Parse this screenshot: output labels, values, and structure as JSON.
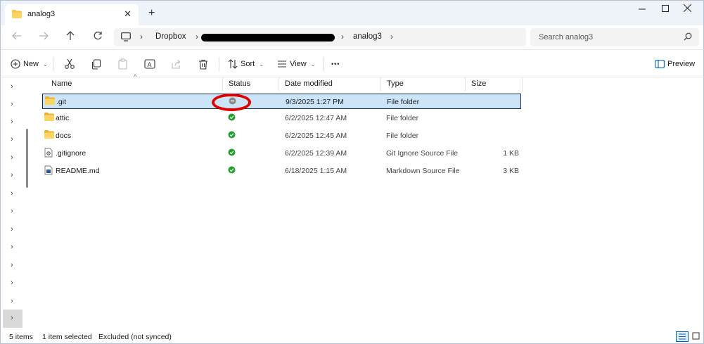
{
  "window": {
    "tab_title": "analog3",
    "new_tab_glyph": "+",
    "tab_close_glyph": "✕"
  },
  "address": {
    "segments": [
      "Dropbox",
      "analog3"
    ],
    "search_placeholder": "Search analog3"
  },
  "toolbar": {
    "new_label": "New",
    "sort_label": "Sort",
    "view_label": "View",
    "more_label": "•••",
    "preview_label": "Preview"
  },
  "columns": {
    "name": "Name",
    "status": "Status",
    "date": "Date modified",
    "type": "Type",
    "size": "Size"
  },
  "files": [
    {
      "name": ".git",
      "status": "excluded",
      "date": "9/3/2025 1:27 PM",
      "type": "File folder",
      "size": "",
      "icon": "folder-icon"
    },
    {
      "name": "attic",
      "status": "synced",
      "date": "6/2/2025 12:47 AM",
      "type": "File folder",
      "size": "",
      "icon": "folder-icon"
    },
    {
      "name": "docs",
      "status": "synced",
      "date": "6/2/2025 12:45 AM",
      "type": "File folder",
      "size": "",
      "icon": "folder-icon"
    },
    {
      "name": ".gitignore",
      "status": "synced",
      "date": "6/2/2025 12:39 AM",
      "type": "Git Ignore Source File",
      "size": "1 KB",
      "icon": "gear-file-icon"
    },
    {
      "name": "README.md",
      "status": "synced",
      "date": "6/18/2025 1:15 AM",
      "type": "Markdown Source File",
      "size": "3 KB",
      "icon": "document-icon"
    }
  ],
  "statusbar": {
    "item_count": "5 items",
    "selection": "1 item selected",
    "sync_state": "Excluded (not synced)"
  },
  "colors": {
    "accent": "#0067c0",
    "selection": "#cce4f7",
    "synced": "#1fa12b",
    "excluded": "#8a8a8a",
    "annotation": "#e00000",
    "folder": "#f8c33e"
  }
}
